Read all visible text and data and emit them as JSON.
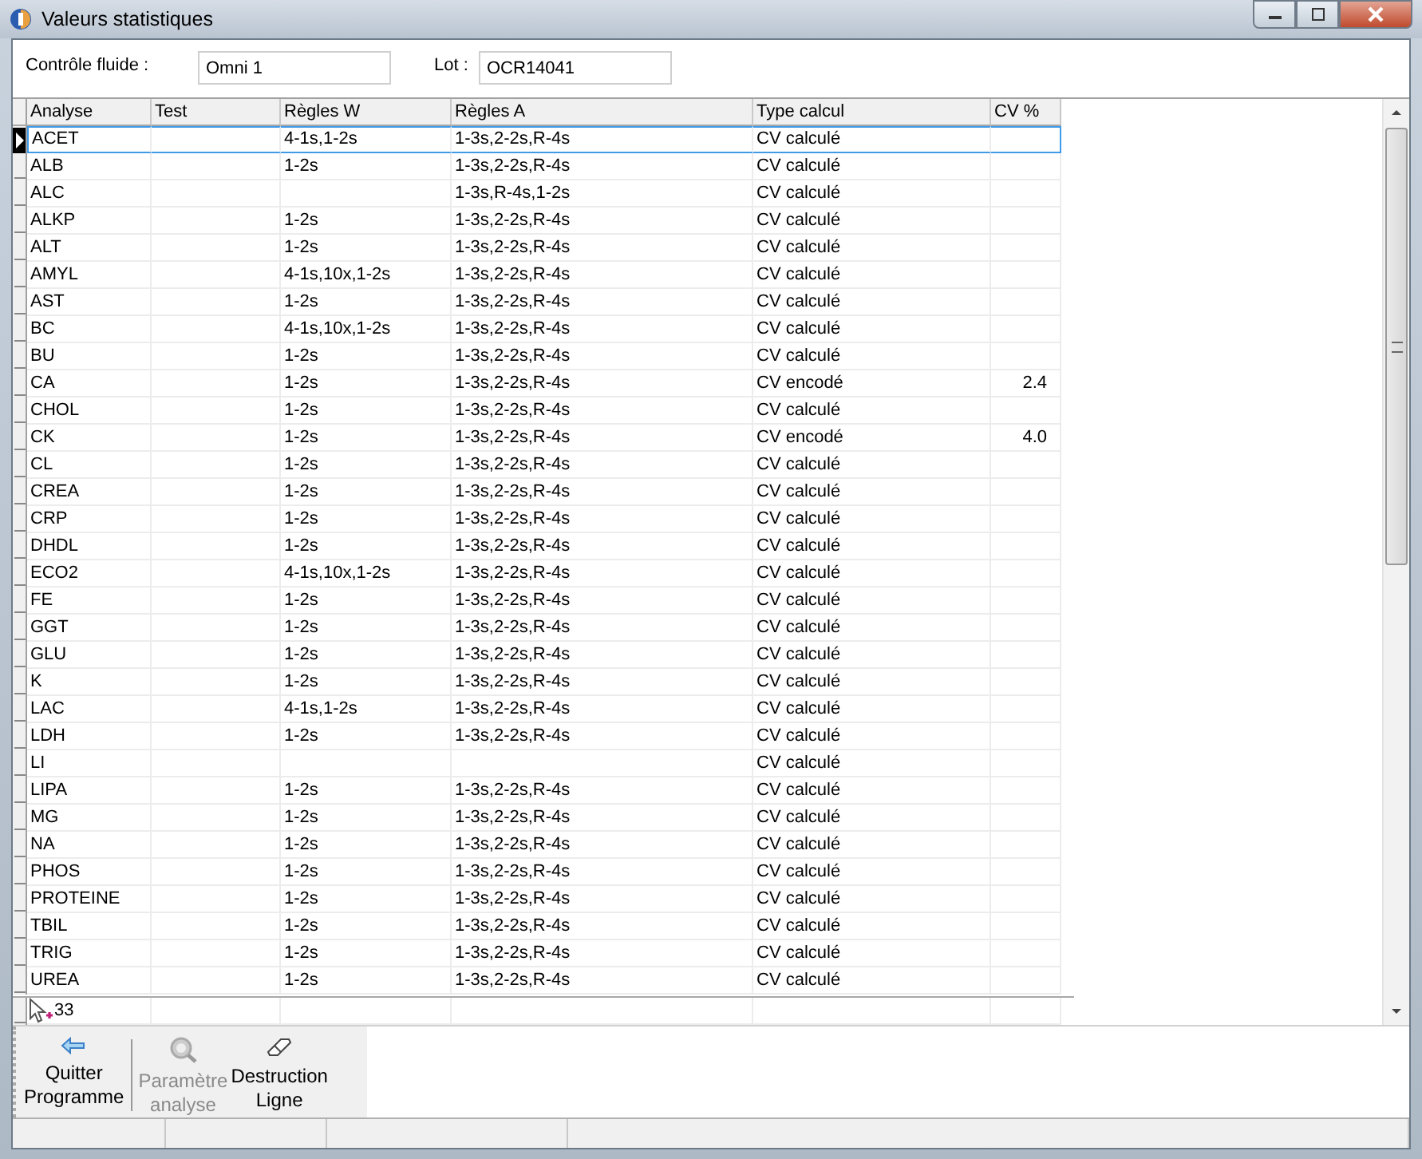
{
  "window": {
    "title": "Valeurs statistiques"
  },
  "header": {
    "fluid_label": "Contrôle fluide :",
    "fluid_value": "Omni 1",
    "lot_label": "Lot :",
    "lot_value": "OCR14041"
  },
  "table": {
    "columns": [
      "Analyse",
      "Test",
      "Règles W",
      "Règles A",
      "Type calcul",
      "CV %"
    ],
    "rows": [
      {
        "analyse": "ACET",
        "regles_w": "4-1s,1-2s",
        "regles_a": "1-3s,2-2s,R-4s",
        "type_calcul": "CV calculé",
        "selected": true
      },
      {
        "analyse": "ALB",
        "regles_w": "1-2s",
        "regles_a": "1-3s,2-2s,R-4s",
        "type_calcul": "CV calculé",
        "selected": false
      },
      {
        "analyse": "ALC",
        "regles_a": "1-3s,R-4s,1-2s",
        "type_calcul": "CV calculé",
        "selected": false
      },
      {
        "analyse": "ALKP",
        "regles_w": "1-2s",
        "regles_a": "1-3s,2-2s,R-4s",
        "type_calcul": "CV calculé",
        "selected": false
      },
      {
        "analyse": "ALT",
        "regles_w": "1-2s",
        "regles_a": "1-3s,2-2s,R-4s",
        "type_calcul": "CV calculé",
        "selected": false
      },
      {
        "analyse": "AMYL",
        "regles_w": "4-1s,10x,1-2s",
        "regles_a": "1-3s,2-2s,R-4s",
        "type_calcul": "CV calculé",
        "selected": false
      },
      {
        "analyse": "AST",
        "regles_w": "1-2s",
        "regles_a": "1-3s,2-2s,R-4s",
        "type_calcul": "CV calculé",
        "selected": false
      },
      {
        "analyse": "BC",
        "regles_w": "4-1s,10x,1-2s",
        "regles_a": "1-3s,2-2s,R-4s",
        "type_calcul": "CV calculé",
        "selected": false
      },
      {
        "analyse": "BU",
        "regles_w": "1-2s",
        "regles_a": "1-3s,2-2s,R-4s",
        "type_calcul": "CV calculé",
        "selected": false
      },
      {
        "analyse": "CA",
        "regles_w": "1-2s",
        "regles_a": "1-3s,2-2s,R-4s",
        "type_calcul": "CV encodé",
        "cv": "2.4",
        "selected": false
      },
      {
        "analyse": "CHOL",
        "regles_w": "1-2s",
        "regles_a": "1-3s,2-2s,R-4s",
        "type_calcul": "CV calculé",
        "selected": false
      },
      {
        "analyse": "CK",
        "regles_w": "1-2s",
        "regles_a": "1-3s,2-2s,R-4s",
        "type_calcul": "CV encodé",
        "cv": "4.0",
        "selected": false
      },
      {
        "analyse": "CL",
        "regles_w": "1-2s",
        "regles_a": "1-3s,2-2s,R-4s",
        "type_calcul": "CV calculé",
        "selected": false
      },
      {
        "analyse": "CREA",
        "regles_w": "1-2s",
        "regles_a": "1-3s,2-2s,R-4s",
        "type_calcul": "CV calculé",
        "selected": false
      },
      {
        "analyse": "CRP",
        "regles_w": "1-2s",
        "regles_a": "1-3s,2-2s,R-4s",
        "type_calcul": "CV calculé",
        "selected": false
      },
      {
        "analyse": "DHDL",
        "regles_w": "1-2s",
        "regles_a": "1-3s,2-2s,R-4s",
        "type_calcul": "CV calculé",
        "selected": false
      },
      {
        "analyse": "ECO2",
        "regles_w": "4-1s,10x,1-2s",
        "regles_a": "1-3s,2-2s,R-4s",
        "type_calcul": "CV calculé",
        "selected": false
      },
      {
        "analyse": "FE",
        "regles_w": "1-2s",
        "regles_a": "1-3s,2-2s,R-4s",
        "type_calcul": "CV calculé",
        "selected": false
      },
      {
        "analyse": "GGT",
        "regles_w": "1-2s",
        "regles_a": "1-3s,2-2s,R-4s",
        "type_calcul": "CV calculé",
        "selected": false
      },
      {
        "analyse": "GLU",
        "regles_w": "1-2s",
        "regles_a": "1-3s,2-2s,R-4s",
        "type_calcul": "CV calculé",
        "selected": false
      },
      {
        "analyse": "K",
        "regles_w": "1-2s",
        "regles_a": "1-3s,2-2s,R-4s",
        "type_calcul": "CV calculé",
        "selected": false
      },
      {
        "analyse": "LAC",
        "regles_w": "4-1s,1-2s",
        "regles_a": "1-3s,2-2s,R-4s",
        "type_calcul": "CV calculé",
        "selected": false
      },
      {
        "analyse": "LDH",
        "regles_w": "1-2s",
        "regles_a": "1-3s,2-2s,R-4s",
        "type_calcul": "CV calculé",
        "selected": false
      },
      {
        "analyse": "LI",
        "type_calcul": "CV calculé",
        "selected": false
      },
      {
        "analyse": "LIPA",
        "regles_w": "1-2s",
        "regles_a": "1-3s,2-2s,R-4s",
        "type_calcul": "CV calculé",
        "selected": false
      },
      {
        "analyse": "MG",
        "regles_w": "1-2s",
        "regles_a": "1-3s,2-2s,R-4s",
        "type_calcul": "CV calculé",
        "selected": false
      },
      {
        "analyse": "NA",
        "regles_w": "1-2s",
        "regles_a": "1-3s,2-2s,R-4s",
        "type_calcul": "CV calculé",
        "selected": false
      },
      {
        "analyse": "PHOS",
        "regles_w": "1-2s",
        "regles_a": "1-3s,2-2s,R-4s",
        "type_calcul": "CV calculé",
        "selected": false
      },
      {
        "analyse": "PROTEINE",
        "regles_w": "1-2s",
        "regles_a": "1-3s,2-2s,R-4s",
        "type_calcul": "CV calculé",
        "selected": false
      },
      {
        "analyse": "TBIL",
        "regles_w": "1-2s",
        "regles_a": "1-3s,2-2s,R-4s",
        "type_calcul": "CV calculé",
        "selected": false
      },
      {
        "analyse": "TRIG",
        "regles_w": "1-2s",
        "regles_a": "1-3s,2-2s,R-4s",
        "type_calcul": "CV calculé",
        "selected": false
      },
      {
        "analyse": "UREA",
        "regles_w": "1-2s",
        "regles_a": "1-3s,2-2s,R-4s",
        "type_calcul": "CV calculé",
        "selected": false
      }
    ],
    "new_row": "33"
  },
  "toolbar": [
    {
      "kind": "back",
      "label": [
        "Quitter",
        "Programme"
      ],
      "disabled": false
    },
    {
      "kind": "search",
      "label": [
        "Paramètre",
        "analyse"
      ],
      "disabled": true
    },
    {
      "kind": "eraser",
      "label": [
        "Destruction",
        "Ligne"
      ],
      "disabled": false
    }
  ]
}
